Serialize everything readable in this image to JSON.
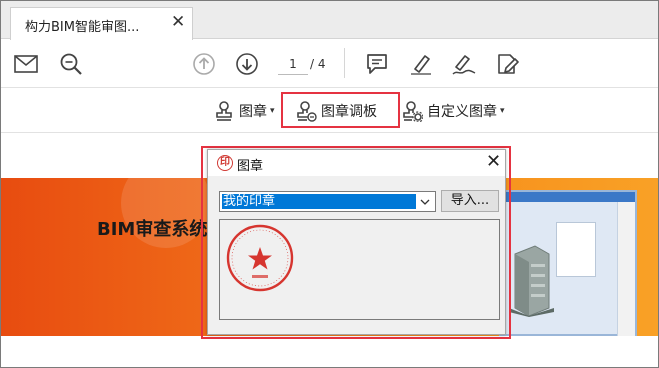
{
  "tab": {
    "title": "构力BIM智能审图...",
    "close_glyph": "✕"
  },
  "toolbar": {
    "icons": [
      "mail-icon",
      "zoom-icon",
      "page-up-icon",
      "page-down-icon",
      "comment-icon",
      "highlight-pen-icon",
      "sign-icon",
      "fill-sign-icon"
    ],
    "page_current": "1",
    "page_total": "/ 4"
  },
  "stampbar": {
    "stamp_label": "图章",
    "palette_label": "图章调板",
    "custom_label": "自定义图章",
    "caret": "▾"
  },
  "banner": {
    "title": "BIM审查系统"
  },
  "dialog": {
    "icon_glyph": "印",
    "title": "图章",
    "close_glyph": "✕",
    "selected_stamp": "我的印章",
    "import_label": "导入..."
  },
  "colors": {
    "accent_red": "#e53341",
    "selection_blue": "#0078d7",
    "banner_orange": "#f0701a",
    "seal_red": "#d6352f"
  }
}
